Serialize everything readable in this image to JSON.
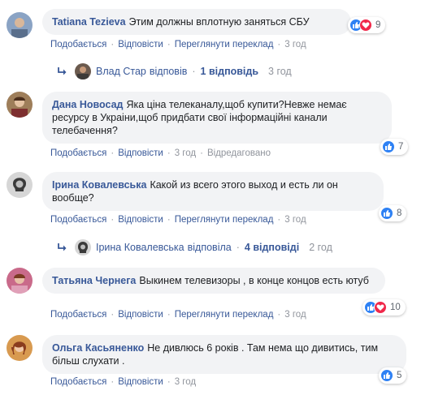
{
  "comments": [
    {
      "author": "Tatiana Tezieva",
      "text": "Этим должны вплотную заняться СБУ",
      "actions": [
        "Подобається",
        "Відповісти",
        "Переглянути переклад"
      ],
      "time": "3 год",
      "reactions": {
        "types": [
          "like",
          "love"
        ],
        "count": "9"
      },
      "reply": {
        "name": "Влад Стар",
        "verb": "відповів",
        "count": "1 відповідь",
        "time": "3 год"
      }
    },
    {
      "author": "Дана Новосад",
      "text": "Яка ціна телеканалу,щоб купити?Невже немає ресурсу в Украіни,щоб придбати свої інформаційні канали телебачення?",
      "actions": [
        "Подобається",
        "Відповісти"
      ],
      "time": "3 год",
      "edited": "Відредаговано",
      "reactions": {
        "types": [
          "like"
        ],
        "count": "7"
      }
    },
    {
      "author": "Ірина Ковалевська",
      "text": "Какой из всего этого выход и есть ли он вообще?",
      "actions": [
        "Подобається",
        "Відповісти",
        "Переглянути переклад"
      ],
      "time": "3 год",
      "reactions": {
        "types": [
          "like"
        ],
        "count": "8"
      },
      "reply": {
        "name": "Ірина Ковалевська",
        "verb": "відповіла",
        "count": "4 відповіді",
        "time": "2 год"
      }
    },
    {
      "author": "Татьяна Чернега",
      "text": "Выкинем телевизоры , в конце концов есть ютуб",
      "actions": [
        "Подобається",
        "Відповісти",
        "Переглянути переклад"
      ],
      "time": "3 год",
      "reactions": {
        "types": [
          "like",
          "love"
        ],
        "count": "10"
      }
    },
    {
      "author": "Ольга Касьяненко",
      "text": "Не дивлюсь 6 років . Там нема що дивитись, тим більш слухати .",
      "actions": [
        "Подобається",
        "Відповісти"
      ],
      "time": "3 год",
      "reactions": {
        "types": [
          "like"
        ],
        "count": "5"
      }
    }
  ],
  "icons": {
    "like": "thumbs-up-icon",
    "love": "heart-icon",
    "reply": "reply-arrow-icon"
  },
  "colors": {
    "link": "#385898",
    "bubble": "#f2f3f5",
    "like": "#2e81f4",
    "love": "#f0284a",
    "muted": "#90949c"
  }
}
